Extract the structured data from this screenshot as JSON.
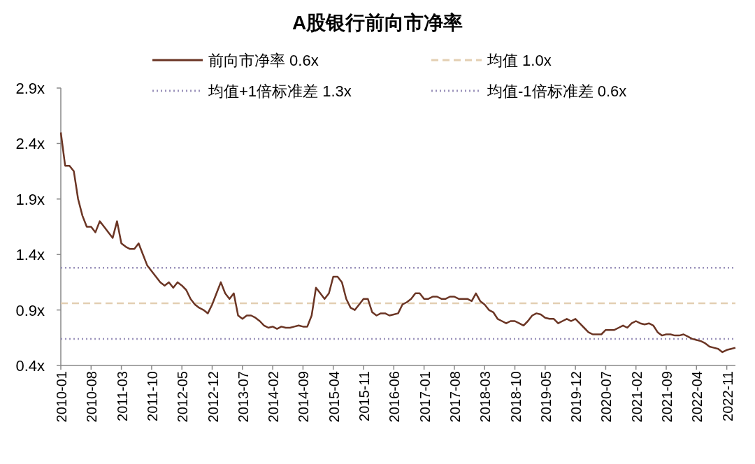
{
  "chart_data": {
    "type": "line",
    "title": "A股银行前向市净率",
    "legend": "top",
    "ylim": [
      0.4,
      2.9
    ],
    "yticks": [
      {
        "value": 0.4,
        "label": "0.4x"
      },
      {
        "value": 0.9,
        "label": "0.9x"
      },
      {
        "value": 1.4,
        "label": "1.4x"
      },
      {
        "value": 1.9,
        "label": "1.9x"
      },
      {
        "value": 2.4,
        "label": "2.4x"
      },
      {
        "value": 2.9,
        "label": "2.9x"
      }
    ],
    "categories": [
      "2010-01",
      null,
      null,
      null,
      null,
      null,
      null,
      "2010-08",
      null,
      null,
      null,
      null,
      null,
      null,
      "2011-03",
      null,
      null,
      null,
      null,
      null,
      null,
      "2011-10",
      null,
      null,
      null,
      null,
      null,
      null,
      "2012-05",
      null,
      null,
      null,
      null,
      null,
      null,
      "2012-12",
      null,
      null,
      null,
      null,
      null,
      null,
      "2013-07",
      null,
      null,
      null,
      null,
      null,
      null,
      "2014-02",
      null,
      null,
      null,
      null,
      null,
      null,
      "2014-09",
      null,
      null,
      null,
      null,
      null,
      null,
      "2015-04",
      null,
      null,
      null,
      null,
      null,
      null,
      "2015-11",
      null,
      null,
      null,
      null,
      null,
      null,
      "2016-06",
      null,
      null,
      null,
      null,
      null,
      null,
      "2017-01",
      null,
      null,
      null,
      null,
      null,
      null,
      "2017-08",
      null,
      null,
      null,
      null,
      null,
      null,
      "2018-03",
      null,
      null,
      null,
      null,
      null,
      null,
      "2018-10",
      null,
      null,
      null,
      null,
      null,
      null,
      "2019-05",
      null,
      null,
      null,
      null,
      null,
      null,
      "2019-12",
      null,
      null,
      null,
      null,
      null,
      null,
      "2020-07",
      null,
      null,
      null,
      null,
      null,
      null,
      "2021-02",
      null,
      null,
      null,
      null,
      null,
      null,
      "2021-09",
      null,
      null,
      null,
      null,
      null,
      null,
      "2022-04",
      null,
      null,
      null,
      null,
      null,
      null,
      "2022-11",
      null,
      null
    ],
    "series": [
      {
        "name": "前向市净率 0.6x",
        "color": "#6b3524",
        "line_style": "solid",
        "values": [
          2.5,
          2.2,
          2.2,
          2.15,
          1.9,
          1.75,
          1.65,
          1.65,
          1.6,
          1.7,
          1.65,
          1.6,
          1.55,
          1.7,
          1.5,
          1.47,
          1.45,
          1.45,
          1.5,
          1.4,
          1.3,
          1.25,
          1.2,
          1.15,
          1.12,
          1.15,
          1.1,
          1.15,
          1.12,
          1.08,
          1.0,
          0.95,
          0.92,
          0.9,
          0.87,
          0.95,
          1.05,
          1.15,
          1.05,
          1.0,
          1.05,
          0.85,
          0.82,
          0.85,
          0.85,
          0.83,
          0.8,
          0.76,
          0.74,
          0.75,
          0.73,
          0.75,
          0.74,
          0.74,
          0.75,
          0.76,
          0.75,
          0.75,
          0.85,
          1.1,
          1.05,
          1.0,
          1.05,
          1.2,
          1.2,
          1.15,
          1.0,
          0.92,
          0.9,
          0.95,
          1.0,
          1.0,
          0.88,
          0.85,
          0.87,
          0.87,
          0.85,
          0.86,
          0.87,
          0.95,
          0.97,
          1.0,
          1.05,
          1.05,
          1.0,
          1.0,
          1.02,
          1.02,
          1.0,
          1.0,
          1.02,
          1.02,
          1.0,
          1.0,
          1.0,
          0.98,
          1.05,
          0.98,
          0.95,
          0.9,
          0.88,
          0.82,
          0.8,
          0.78,
          0.8,
          0.8,
          0.78,
          0.76,
          0.8,
          0.85,
          0.87,
          0.86,
          0.83,
          0.82,
          0.82,
          0.78,
          0.8,
          0.82,
          0.8,
          0.82,
          0.78,
          0.74,
          0.7,
          0.68,
          0.68,
          0.68,
          0.72,
          0.72,
          0.72,
          0.74,
          0.76,
          0.74,
          0.78,
          0.8,
          0.78,
          0.77,
          0.78,
          0.76,
          0.7,
          0.67,
          0.68,
          0.68,
          0.67,
          0.67,
          0.68,
          0.66,
          0.64,
          0.63,
          0.62,
          0.6,
          0.57,
          0.56,
          0.55,
          0.52,
          0.54,
          0.55,
          0.56
        ]
      },
      {
        "name": "均值 1.0x",
        "color": "#e3cfb2",
        "line_style": "dashed",
        "values": [
          0.96,
          0.96,
          0.96,
          0.96,
          0.96,
          0.96,
          0.96,
          0.96,
          0.96,
          0.96,
          0.96,
          0.96,
          0.96,
          0.96,
          0.96,
          0.96,
          0.96,
          0.96,
          0.96,
          0.96,
          0.96,
          0.96,
          0.96,
          0.96,
          0.96,
          0.96,
          0.96,
          0.96,
          0.96,
          0.96,
          0.96,
          0.96,
          0.96,
          0.96,
          0.96,
          0.96,
          0.96,
          0.96,
          0.96,
          0.96,
          0.96,
          0.96,
          0.96,
          0.96,
          0.96,
          0.96,
          0.96,
          0.96,
          0.96,
          0.96,
          0.96,
          0.96,
          0.96,
          0.96,
          0.96,
          0.96,
          0.96,
          0.96,
          0.96,
          0.96,
          0.96,
          0.96,
          0.96,
          0.96,
          0.96,
          0.96,
          0.96,
          0.96,
          0.96,
          0.96,
          0.96,
          0.96,
          0.96,
          0.96,
          0.96,
          0.96,
          0.96,
          0.96,
          0.96,
          0.96,
          0.96,
          0.96,
          0.96,
          0.96,
          0.96,
          0.96,
          0.96,
          0.96,
          0.96,
          0.96,
          0.96,
          0.96,
          0.96,
          0.96,
          0.96,
          0.96,
          0.96,
          0.96,
          0.96,
          0.96,
          0.96,
          0.96,
          0.96,
          0.96,
          0.96,
          0.96,
          0.96,
          0.96,
          0.96,
          0.96,
          0.96,
          0.96,
          0.96,
          0.96,
          0.96,
          0.96,
          0.96,
          0.96,
          0.96,
          0.96,
          0.96,
          0.96,
          0.96,
          0.96,
          0.96,
          0.96,
          0.96,
          0.96,
          0.96,
          0.96,
          0.96,
          0.96,
          0.96,
          0.96,
          0.96,
          0.96,
          0.96,
          0.96,
          0.96,
          0.96,
          0.96,
          0.96,
          0.96,
          0.96,
          0.96,
          0.96,
          0.96,
          0.96,
          0.96,
          0.96,
          0.96,
          0.96,
          0.96,
          0.96,
          0.96,
          0.96,
          0.96
        ]
      },
      {
        "name": "均值+1倍标准差 1.3x",
        "color": "#9b93bb",
        "line_style": "dotted",
        "values": [
          1.28,
          1.28,
          1.28,
          1.28,
          1.28,
          1.28,
          1.28,
          1.28,
          1.28,
          1.28,
          1.28,
          1.28,
          1.28,
          1.28,
          1.28,
          1.28,
          1.28,
          1.28,
          1.28,
          1.28,
          1.28,
          1.28,
          1.28,
          1.28,
          1.28,
          1.28,
          1.28,
          1.28,
          1.28,
          1.28,
          1.28,
          1.28,
          1.28,
          1.28,
          1.28,
          1.28,
          1.28,
          1.28,
          1.28,
          1.28,
          1.28,
          1.28,
          1.28,
          1.28,
          1.28,
          1.28,
          1.28,
          1.28,
          1.28,
          1.28,
          1.28,
          1.28,
          1.28,
          1.28,
          1.28,
          1.28,
          1.28,
          1.28,
          1.28,
          1.28,
          1.28,
          1.28,
          1.28,
          1.28,
          1.28,
          1.28,
          1.28,
          1.28,
          1.28,
          1.28,
          1.28,
          1.28,
          1.28,
          1.28,
          1.28,
          1.28,
          1.28,
          1.28,
          1.28,
          1.28,
          1.28,
          1.28,
          1.28,
          1.28,
          1.28,
          1.28,
          1.28,
          1.28,
          1.28,
          1.28,
          1.28,
          1.28,
          1.28,
          1.28,
          1.28,
          1.28,
          1.28,
          1.28,
          1.28,
          1.28,
          1.28,
          1.28,
          1.28,
          1.28,
          1.28,
          1.28,
          1.28,
          1.28,
          1.28,
          1.28,
          1.28,
          1.28,
          1.28,
          1.28,
          1.28,
          1.28,
          1.28,
          1.28,
          1.28,
          1.28,
          1.28,
          1.28,
          1.28,
          1.28,
          1.28,
          1.28,
          1.28,
          1.28,
          1.28,
          1.28,
          1.28,
          1.28,
          1.28,
          1.28,
          1.28,
          1.28,
          1.28,
          1.28,
          1.28,
          1.28,
          1.28,
          1.28,
          1.28,
          1.28,
          1.28,
          1.28,
          1.28,
          1.28,
          1.28,
          1.28,
          1.28,
          1.28,
          1.28,
          1.28,
          1.28,
          1.28,
          1.28
        ]
      },
      {
        "name": "均值-1倍标准差 0.6x",
        "color": "#9b93bb",
        "line_style": "dotted",
        "values": [
          0.64,
          0.64,
          0.64,
          0.64,
          0.64,
          0.64,
          0.64,
          0.64,
          0.64,
          0.64,
          0.64,
          0.64,
          0.64,
          0.64,
          0.64,
          0.64,
          0.64,
          0.64,
          0.64,
          0.64,
          0.64,
          0.64,
          0.64,
          0.64,
          0.64,
          0.64,
          0.64,
          0.64,
          0.64,
          0.64,
          0.64,
          0.64,
          0.64,
          0.64,
          0.64,
          0.64,
          0.64,
          0.64,
          0.64,
          0.64,
          0.64,
          0.64,
          0.64,
          0.64,
          0.64,
          0.64,
          0.64,
          0.64,
          0.64,
          0.64,
          0.64,
          0.64,
          0.64,
          0.64,
          0.64,
          0.64,
          0.64,
          0.64,
          0.64,
          0.64,
          0.64,
          0.64,
          0.64,
          0.64,
          0.64,
          0.64,
          0.64,
          0.64,
          0.64,
          0.64,
          0.64,
          0.64,
          0.64,
          0.64,
          0.64,
          0.64,
          0.64,
          0.64,
          0.64,
          0.64,
          0.64,
          0.64,
          0.64,
          0.64,
          0.64,
          0.64,
          0.64,
          0.64,
          0.64,
          0.64,
          0.64,
          0.64,
          0.64,
          0.64,
          0.64,
          0.64,
          0.64,
          0.64,
          0.64,
          0.64,
          0.64,
          0.64,
          0.64,
          0.64,
          0.64,
          0.64,
          0.64,
          0.64,
          0.64,
          0.64,
          0.64,
          0.64,
          0.64,
          0.64,
          0.64,
          0.64,
          0.64,
          0.64,
          0.64,
          0.64,
          0.64,
          0.64,
          0.64,
          0.64,
          0.64,
          0.64,
          0.64,
          0.64,
          0.64,
          0.64,
          0.64,
          0.64,
          0.64,
          0.64,
          0.64,
          0.64,
          0.64,
          0.64,
          0.64,
          0.64,
          0.64,
          0.64,
          0.64,
          0.64,
          0.64,
          0.64,
          0.64,
          0.64,
          0.64,
          0.64,
          0.64,
          0.64,
          0.64,
          0.64,
          0.64,
          0.64,
          0.64
        ]
      }
    ]
  }
}
